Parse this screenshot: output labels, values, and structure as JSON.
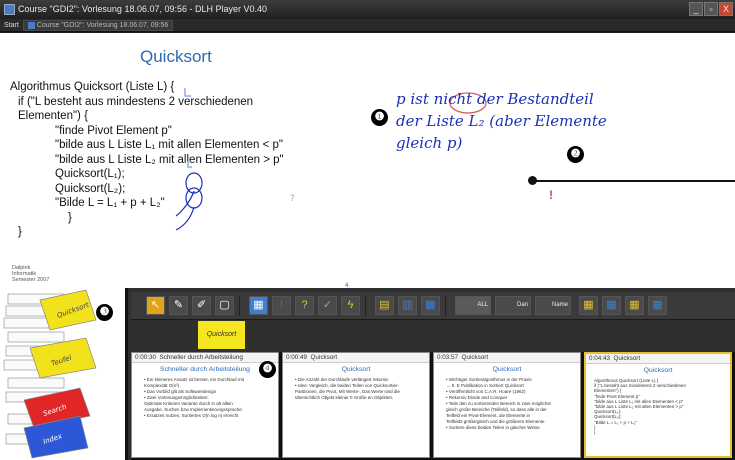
{
  "window": {
    "title": "Course \"GDI2\": Vorlesung 18.06.07, 09:56 - DLH Player V0.40",
    "buttons": [
      "_",
      "▫",
      "X"
    ]
  },
  "taskbar": {
    "start": "Start",
    "tabs": [
      {
        "label": "Course \"GDI2\": Vorlesung 18.06.07, 09:56"
      },
      {
        "label": ""
      }
    ]
  },
  "slide": {
    "title": "Quicksort",
    "code": [
      "Algorithmus Quicksort (Liste L) {",
      "if (\"L besteht aus mindestens 2 verschiedenen",
      "Elementen\") {",
      "\"finde Pivot Element p\"",
      "\"bilde aus L Liste L₁ mit allen Elementen < p\"",
      "\"bilde aus L Liste L₂ mit allen Elementen > p\"",
      "Quicksort(L₁);",
      "Quicksort(L₂);",
      "\"Bilde L = L₁ + p + L₂\"",
      "}",
      "}"
    ],
    "handwriting": [
      "p ist nicht der Bestandteil",
      "der Liste L₂ (aber Elemente",
      "gleich p)"
    ],
    "logo": "Dalpink\nInformatik\nSemester 2007",
    "page_number": "4"
  },
  "annotations": {
    "bubble_1": "❶",
    "bubble_2": "❷",
    "bubble_3": "❸",
    "bubble_4": "❹"
  },
  "overview": {
    "cards": [
      "Quicksort",
      "Teufel",
      "Search",
      "Index"
    ]
  },
  "toolbar": {
    "tools": [
      "arrow",
      "marker",
      "highlighter",
      "slide-tool",
      "image",
      "exclamation",
      "question",
      "check",
      "lightning",
      "split-view",
      "split-view-2",
      "grid"
    ],
    "wide_tools": [
      "ALL",
      "Dan",
      "Name"
    ],
    "small_tools": [
      "",
      "",
      "",
      ""
    ]
  },
  "strip": {
    "note": "Quicksort"
  },
  "thumbnails": [
    {
      "time": "0:00:30",
      "label": "Schneller durch Arbeitsteilung",
      "title": "Schneller durch Arbeitsteilung",
      "lines": [
        "• Ein kleineres Ansatz ist besser, ein Durchlauf mit",
        "  Komplexität O(n²)",
        "• Das Vorbild gilt als Softwaredesign",
        "• Zwei Vorlesungsmöglichkeiten:",
        "  Optimale Kriterien Variante durch in alt allein",
        "  Ausgabe, Suchen bzw Implementierungssprache",
        "• Ersatzes nutzen, Sortiertes O(n log n) erreicht"
      ],
      "active": false
    },
    {
      "time": "0:00:49",
      "label": "Quicksort",
      "title": "Quicksort",
      "lines": [
        "• Die Anzahl der Durchläufe verlängert rekursiv",
        "",
        "• Idee: Vergleich, die beiden Teilen von Quicksortier-",
        "  Partitionen, die Pivot, Mit Werte-, Das Werte sind die",
        "  übersichtlich Objekt kleiner 0 Größe en Objekten."
      ],
      "active": false
    },
    {
      "time": "0:03:57",
      "label": "Quicksort",
      "title": "Quicksort",
      "lines": [
        "• Wichtiger Sortieralgorithmus in der Praxis",
        "  → II. E Publikation in Sortiert Quicksort",
        "• Veröffentlicht von C.A.R. Hoare (1962)",
        "",
        "• Rekursiv Divide and Conquer",
        "• Teile den zu sortierenden Bereich in zwei möglichst",
        "  gleich große Bereiche (Teilfeld), so dass alle in der",
        "  Teilfeld ein Pivot-Element, die Elemente in",
        "  Teilfeld2 größergleich und die größeren Elemente",
        "• Sortiere diese beiden Teilen in gleicher Weise"
      ],
      "active": false
    },
    {
      "time": "0:04:43",
      "label": "Quicksort",
      "title": "Quicksort",
      "lines": [
        "Algorithmus Quicksort (Liste L) {",
        "  if (\"L besteht aus mindestens 2 verschiedenen",
        "  Elementen\") {",
        "    \"finde Pivot Element p\"",
        "    \"bilde aus L Liste L₁ mit allen Elementen < p\"",
        "    \"bilde aus L Liste L₂ mit allen Elementen > p\"",
        "    Quicksort(L₁);",
        "    Quicksort(L₂);",
        "    \"Bilde L = L₁ + p + L₂\"",
        "  }",
        "}"
      ],
      "active": true
    }
  ]
}
